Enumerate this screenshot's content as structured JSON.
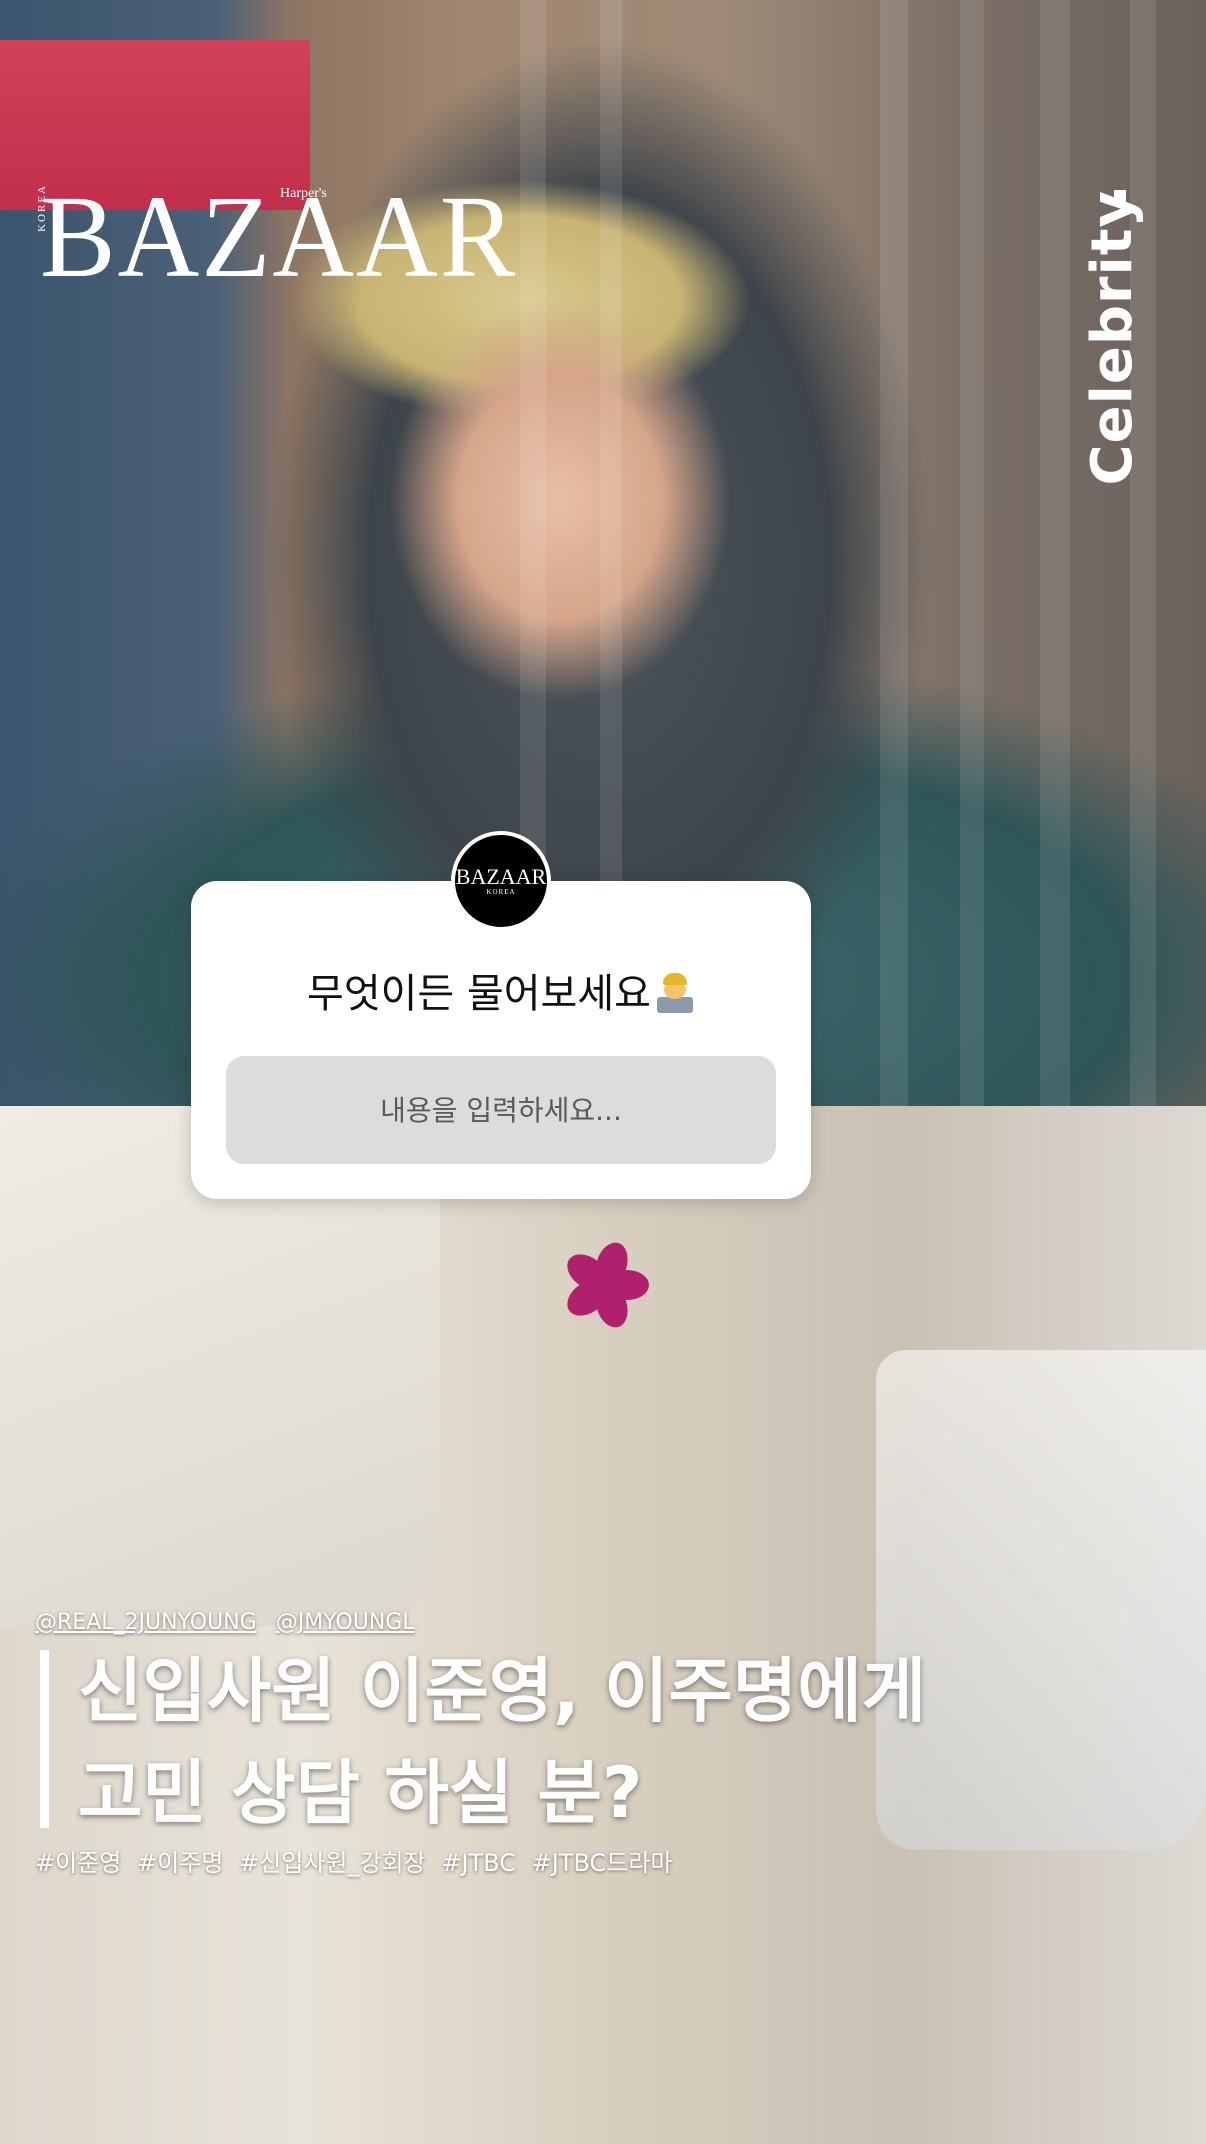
{
  "brand": {
    "logo": "BAZAAR",
    "sub_logo": "Harper's",
    "side_label": "KOREA"
  },
  "category": "Celebrity",
  "sticker": {
    "avatar_logo": "BAZAAR",
    "avatar_sub": "KOREA",
    "prompt": "무엇이든 물어보세요",
    "prompt_emoji": "technologist-emoji",
    "input_placeholder": "내용을 입력하세요..."
  },
  "caption": {
    "mentions": [
      "@REAL_2JUNYOUNG",
      "@JMYOUNGL"
    ],
    "headline_line1": "신입사원 이준영, 이주명에게",
    "headline_line2": "고민 상담 하실 분?",
    "hashtags": [
      "#이준영",
      "#이주명",
      "#신입사원_강회장",
      "#JTBC",
      "#JTBC드라마"
    ]
  },
  "colors": {
    "sticker_bg": "#ffffff",
    "input_bg": "#dcdcdc",
    "text_overlay": "#ffffff"
  }
}
